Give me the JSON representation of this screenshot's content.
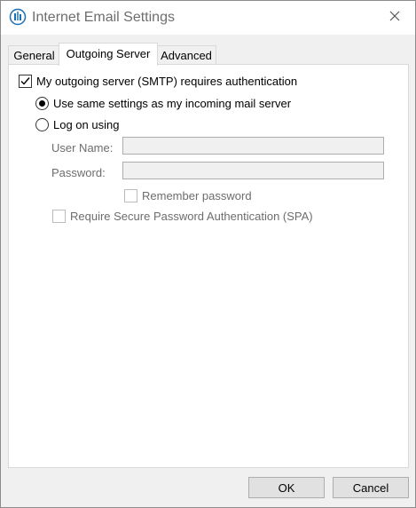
{
  "window": {
    "title": "Internet Email Settings"
  },
  "tabs": [
    {
      "label": "General"
    },
    {
      "label": "Outgoing Server"
    },
    {
      "label": "Advanced"
    }
  ],
  "outgoing": {
    "auth_required_label": "My outgoing server (SMTP) requires authentication",
    "auth_required_checked": true,
    "use_same_label": "Use same settings as my incoming mail server",
    "log_on_label": "Log on using",
    "selected_option": "use_same",
    "username_label": "User Name:",
    "username_value": "",
    "password_label": "Password:",
    "password_value": "",
    "remember_label": "Remember password",
    "spa_label": "Require Secure Password Authentication (SPA)"
  },
  "footer": {
    "ok_label": "OK",
    "cancel_label": "Cancel"
  },
  "icons": {
    "app": "mail-settings-icon",
    "close": "close-icon",
    "check": "checkmark-icon"
  }
}
